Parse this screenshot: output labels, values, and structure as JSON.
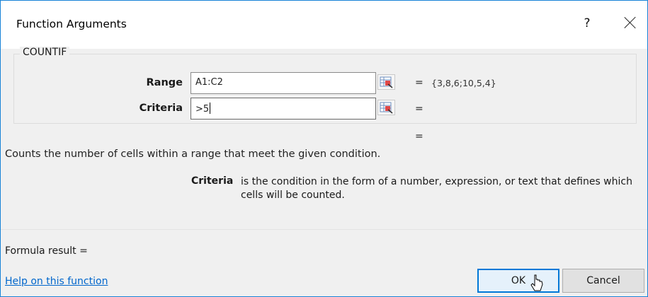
{
  "dialog": {
    "title": "Function Arguments",
    "help_glyph": "?",
    "close_icon": "close-icon"
  },
  "function": {
    "name": "COUNTIF",
    "args": [
      {
        "label": "Range",
        "value": "A1:C2",
        "equals": "=",
        "result": "{3,8,6;10,5,4}"
      },
      {
        "label": "Criteria",
        "value": ">5",
        "equals": "=",
        "result": ""
      }
    ],
    "overall_equals": "="
  },
  "description": "Counts the number of cells within a range that meet the given condition.",
  "arg_help": {
    "name": "Criteria",
    "text": "is the condition in the form of a number, expression, or text that defines which cells will be counted."
  },
  "formula_result": "Formula result =",
  "help_link": "Help on this function",
  "buttons": {
    "ok": "OK",
    "cancel": "Cancel"
  },
  "colors": {
    "accent": "#0078d7",
    "link": "#0066cc",
    "border": "#1883d7"
  }
}
